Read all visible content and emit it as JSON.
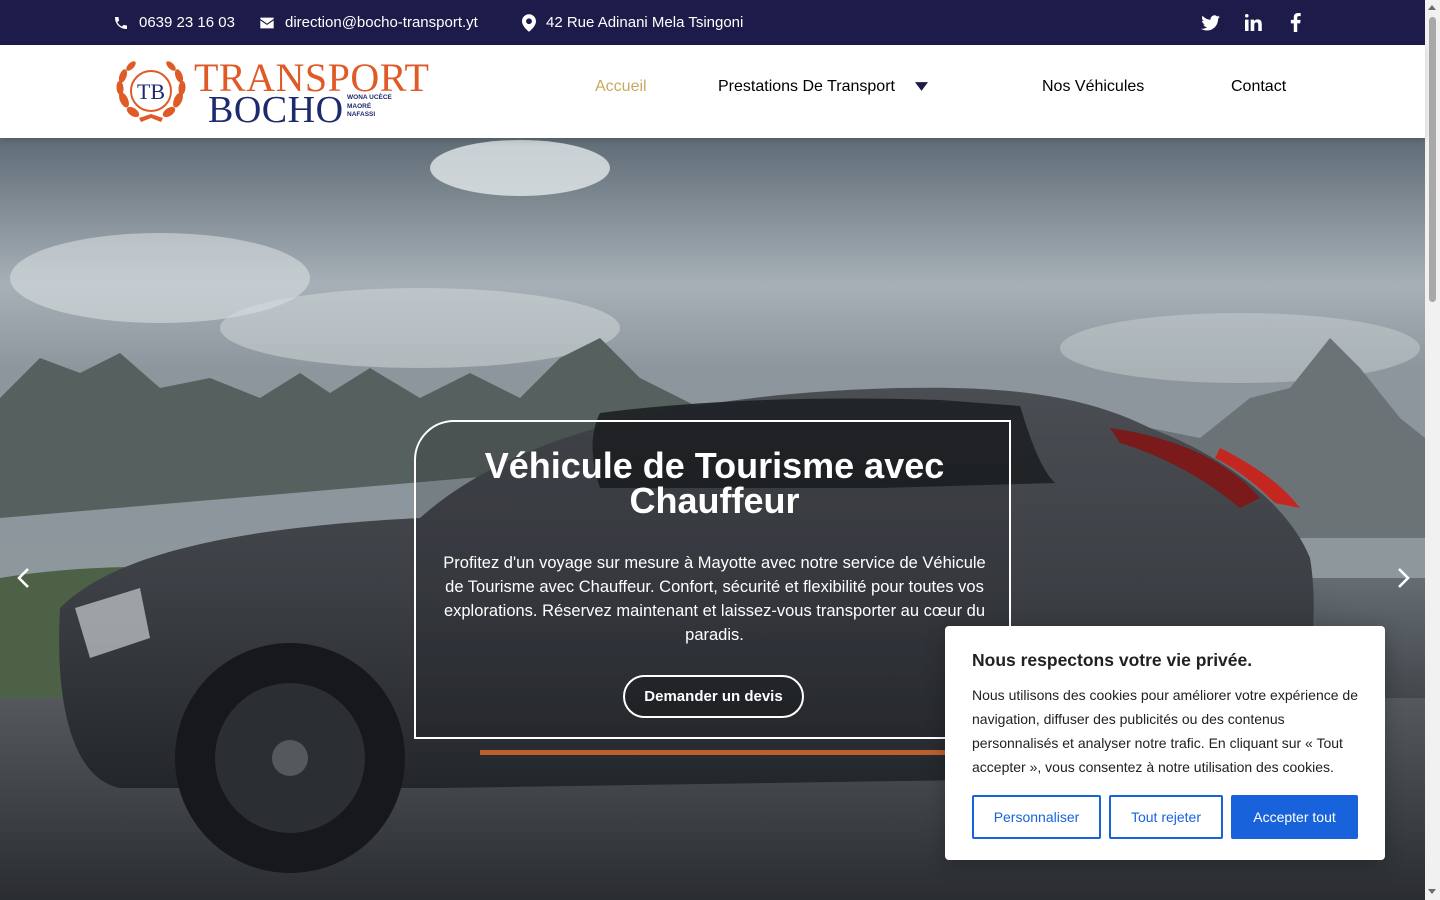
{
  "topbar": {
    "phone": "0639 23 16 03",
    "email": "direction@bocho-transport.yt",
    "address": "42 Rue Adinani Mela Tsingoni",
    "social": [
      "twitter-icon",
      "linkedin-icon",
      "facebook-icon"
    ]
  },
  "logo": {
    "monogram": "TB",
    "word1": "TRANSPORT",
    "word2": "BOCHO",
    "tagline": [
      "WONA UCÈCE",
      "MAORÉ",
      "NAFASSI"
    ]
  },
  "nav": {
    "items": [
      "Accueil",
      "Prestations De Transport",
      "Nos Véhicules",
      "Contact"
    ],
    "active": "Accueil"
  },
  "hero": {
    "title": "Véhicule de Tourisme avec Chauffeur",
    "text": "Profitez d'un voyage sur mesure à Mayotte avec notre service de Véhicule de Tourisme avec Chauffeur. Confort, sécurité et flexibilité pour toutes vos explorations. Réservez maintenant et laissez-vous transporter au cœur du paradis.",
    "button": "Demander un devis"
  },
  "cookie": {
    "title": "Nous respectons votre vie privée.",
    "text": "Nous utilisons des cookies pour améliorer votre expérience de navigation, diffuser des publicités ou des contenus personnalisés et analyser notre trafic. En cliquant sur « Tout accepter », vous consentez à notre utilisation des cookies.",
    "customize": "Personnaliser",
    "reject": "Tout rejeter",
    "accept": "Accepter tout"
  },
  "colors": {
    "topbar": "#1c1b49",
    "nav_active": "#c9a961",
    "logo_orange": "#e05a27",
    "logo_blue": "#1e2a6e",
    "cookie_blue": "#1863dc"
  }
}
